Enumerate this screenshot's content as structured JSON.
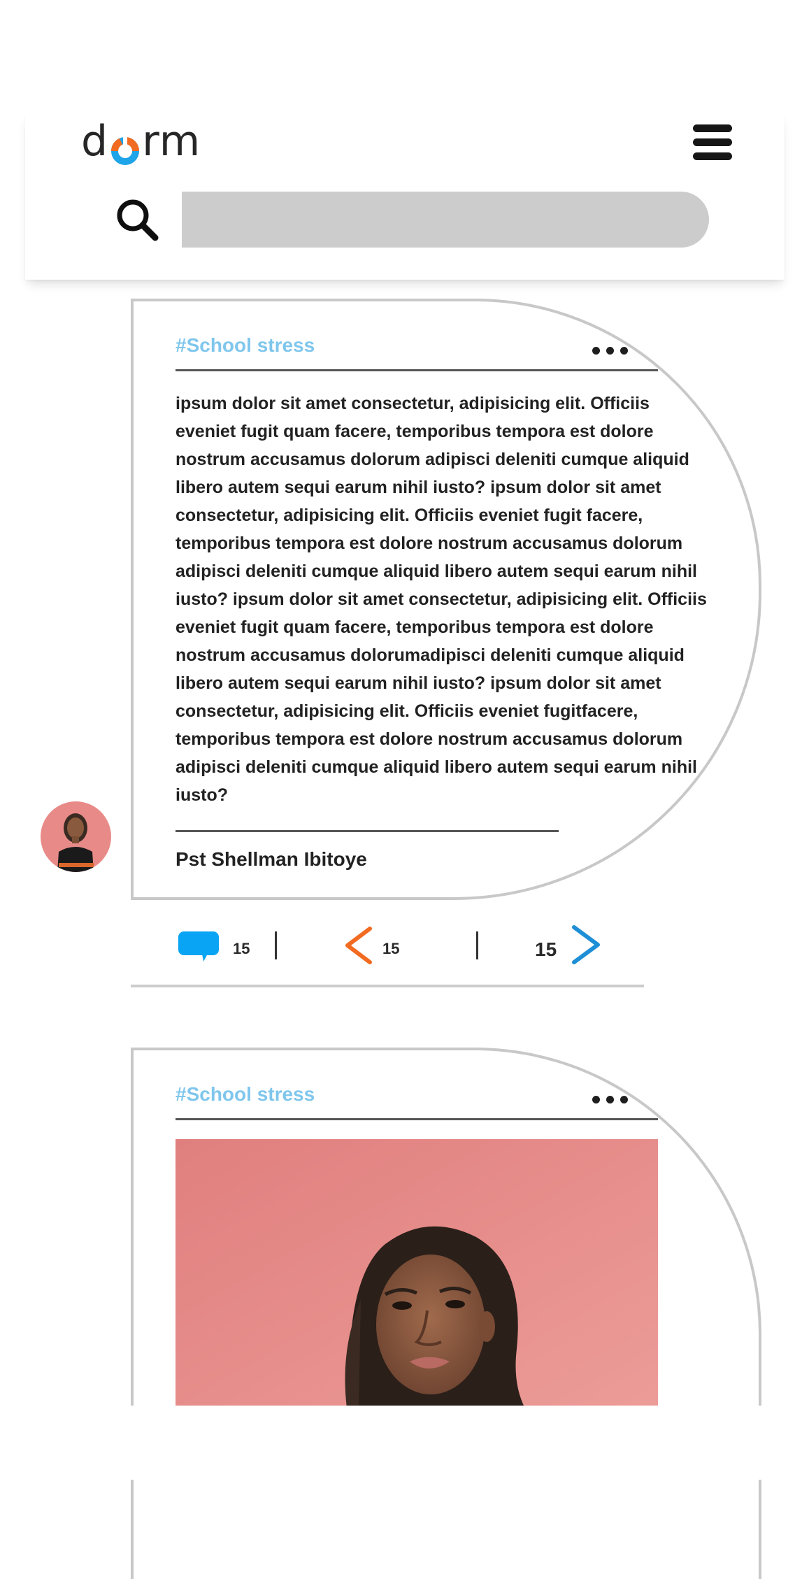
{
  "header": {
    "logo_text_left": "d",
    "logo_text_right": "rm",
    "logo_colors": {
      "orange": "#f26b21",
      "blue": "#1ea4e9"
    },
    "menu_icon": "hamburger-icon",
    "search_icon": "search-icon",
    "search_placeholder": ""
  },
  "posts": [
    {
      "tag": "#School stress",
      "more_icon": "more-dots-icon",
      "body": "ipsum dolor sit amet consectetur, adipisicing elit. Officiis eveniet fugit quam facere, temporibus tempora est dolore nostrum accusamus dolorum adipisci deleniti cumque aliquid libero autem sequi earum nihil iusto? ipsum dolor sit amet consectetur, adipisicing elit. Officiis eveniet fugit facere, temporibus tempora est dolore nostrum accusamus dolorum adipisci deleniti cumque aliquid libero autem sequi earum nihil iusto? ipsum dolor sit amet consectetur, adipisicing elit. Officiis eveniet fugit quam facere, temporibus tempora est dolore nostrum accusamus dolorumadipisci deleniti cumque aliquid libero autem sequi earum nihil iusto? ipsum dolor sit amet consectetur, adipisicing elit. Officiis eveniet fugitfacere, temporibus tempora est dolore nostrum accusamus dolorum adipisci deleniti cumque aliquid libero autem sequi earum nihil iusto?",
      "author": "Pst Shellman Ibitoye",
      "actions": {
        "comments": "15",
        "left_count": "15",
        "right_count": "15"
      }
    },
    {
      "tag": "#School stress",
      "more_icon": "more-dots-icon",
      "image": "woman-portrait-photo"
    }
  ],
  "colors": {
    "tag": "#7fc6ec",
    "comment_icon": "#0aa4f5",
    "left_chevron": "#f26b21",
    "right_chevron": "#1e8fd6",
    "card_border": "#c8c8c8"
  }
}
